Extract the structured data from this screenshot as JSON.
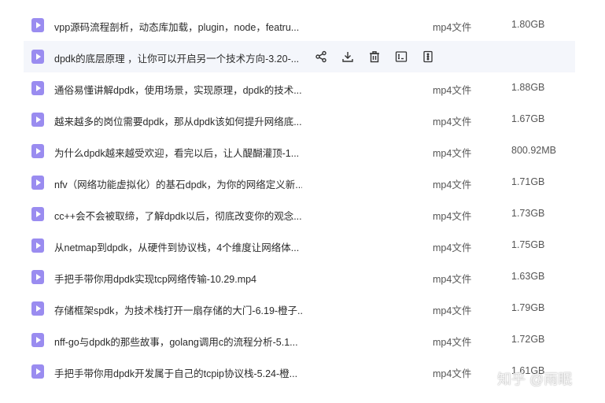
{
  "files": [
    {
      "name": "vpp源码流程剖析，动态库加载，plugin，node，featru...",
      "type": "mp4文件",
      "size": "1.80GB"
    },
    {
      "name": "dpdk的底层原理 ，让你可以开启另一个技术方向-3.20-...",
      "type": "",
      "size": ""
    },
    {
      "name": "通俗易懂讲解dpdk，使用场景，实现原理，dpdk的技术...",
      "type": "mp4文件",
      "size": "1.88GB"
    },
    {
      "name": "越来越多的岗位需要dpdk，那从dpdk该如何提升网络底...",
      "type": "mp4文件",
      "size": "1.67GB"
    },
    {
      "name": "为什么dpdk越来越受欢迎，看完以后，让人醍醐灌顶-1...",
      "type": "mp4文件",
      "size": "800.92MB"
    },
    {
      "name": "nfv（网络功能虚拟化）的基石dpdk，为你的网络定义新...",
      "type": "mp4文件",
      "size": "1.71GB"
    },
    {
      "name": "cc++会不会被取缔，了解dpdk以后，彻底改变你的观念...",
      "type": "mp4文件",
      "size": "1.73GB"
    },
    {
      "name": "从netmap到dpdk，从硬件到协议栈，4个维度让网络体...",
      "type": "mp4文件",
      "size": "1.75GB"
    },
    {
      "name": "手把手带你用dpdk实现tcp网络传输-10.29.mp4",
      "type": "mp4文件",
      "size": "1.63GB"
    },
    {
      "name": "存储框架spdk，为技术栈打开一扇存储的大门-6.19-橙子...",
      "type": "mp4文件",
      "size": "1.79GB"
    },
    {
      "name": "nff-go与dpdk的那些故事，golang调用c的流程分析-5.1...",
      "type": "mp4文件",
      "size": "1.72GB"
    },
    {
      "name": "手把手带你用dpdk开发属于自己的tcpip协议栈-5.24-橙...",
      "type": "mp4文件",
      "size": "1.61GB"
    }
  ],
  "hover_row_index": 1,
  "actions": [
    "share-icon",
    "download-icon",
    "delete-icon",
    "rename-icon",
    "more-icon"
  ],
  "watermark": "知乎 @雨眠",
  "colors": {
    "file_icon": "#9a8cf0",
    "hover_bg": "#f4f6fb"
  }
}
